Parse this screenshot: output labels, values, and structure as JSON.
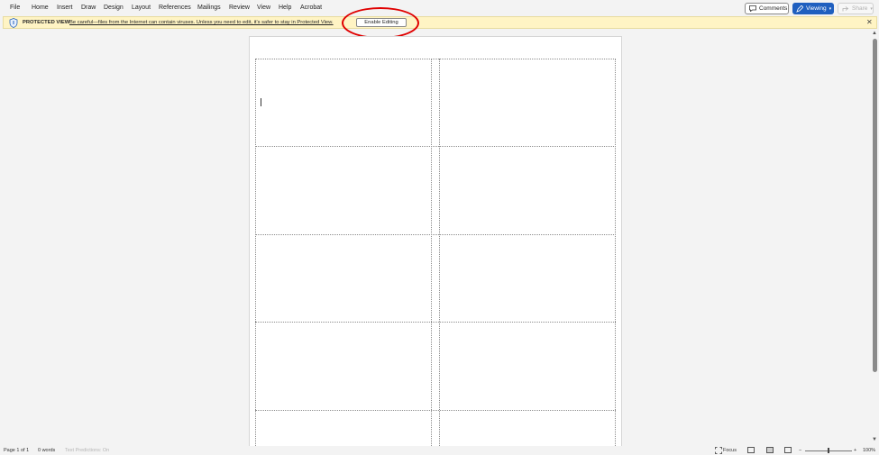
{
  "menu": {
    "items": [
      "File",
      "Home",
      "Insert",
      "Draw",
      "Design",
      "Layout",
      "References",
      "Mailings",
      "Review",
      "View",
      "Help",
      "Acrobat"
    ],
    "comments_label": "Comments",
    "viewing_label": "Viewing",
    "share_label": "Share"
  },
  "protected_view": {
    "title": "PROTECTED VIEW",
    "message": "Be careful—files from the Internet can contain viruses. Unless you need to edit, it's safer to stay in Protected View.",
    "button_label": "Enable Editing",
    "close_glyph": "✕"
  },
  "status": {
    "page": "Page 1 of 1",
    "words": "0 words",
    "text_predictions": "Text Predictions: On",
    "focus": "Focus",
    "zoom": "100%",
    "zoom_minus": "−",
    "zoom_plus": "+"
  },
  "icons": {
    "shield": "shield-icon",
    "comment": "comment-icon",
    "pen": "pen-icon",
    "share": "share-icon",
    "close": "close-icon",
    "focus": "focus-icon"
  },
  "colors": {
    "accent": "#1f5fbf",
    "warning_bar": "#fff4c4",
    "highlight": "#e00000"
  }
}
